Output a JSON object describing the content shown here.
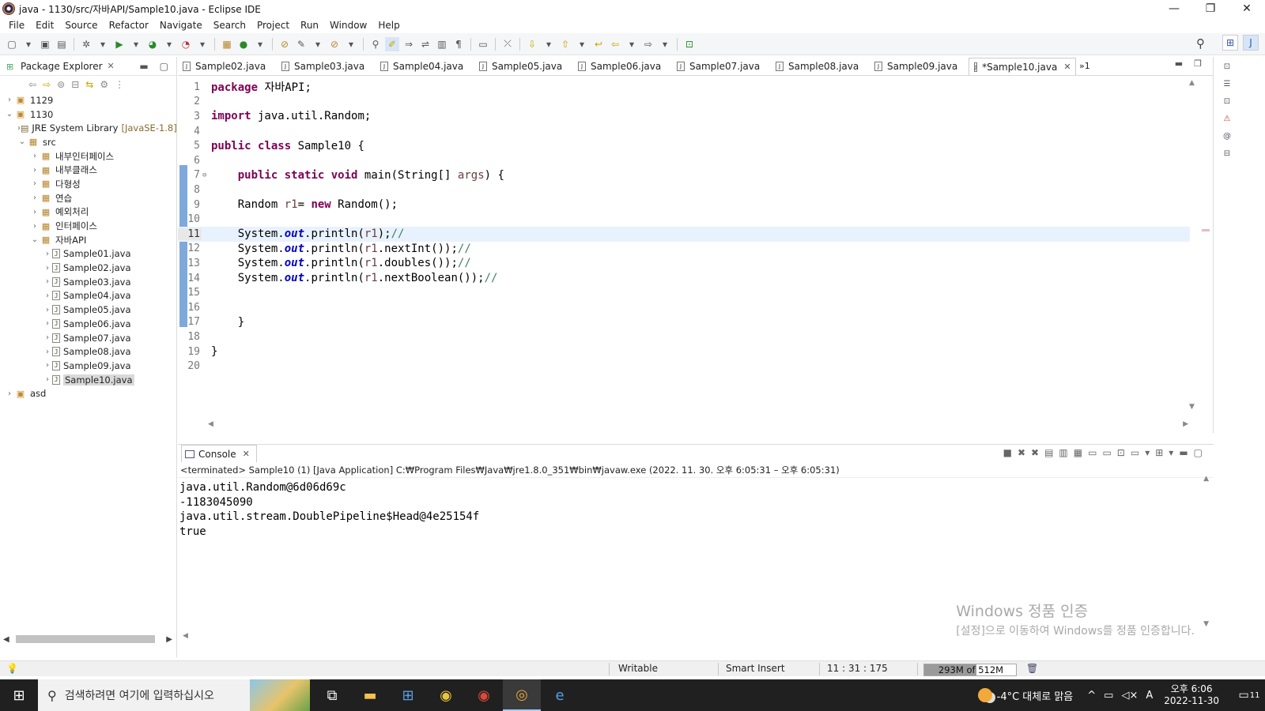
{
  "window": {
    "title": "java - 1130/src/자바API/Sample10.java - Eclipse IDE",
    "controls": [
      "—",
      "❐",
      "✕"
    ]
  },
  "menu": [
    "File",
    "Edit",
    "Source",
    "Refactor",
    "Navigate",
    "Search",
    "Project",
    "Run",
    "Window",
    "Help"
  ],
  "package_explorer": {
    "title": "Package Explorer",
    "tree": [
      {
        "label": "1129",
        "twisty": "›",
        "icon": "project-icon",
        "indent": 0
      },
      {
        "label": "1130",
        "twisty": "⌄",
        "icon": "project-icon",
        "indent": 0
      },
      {
        "label": "JRE System Library",
        "extra": "[JavaSE-1.8]",
        "twisty": "›",
        "icon": "library-icon",
        "indent": 1
      },
      {
        "label": "src",
        "twisty": "⌄",
        "icon": "source-folder-icon",
        "indent": 1
      },
      {
        "label": "내부인터페이스",
        "twisty": "›",
        "icon": "package-icon",
        "indent": 2
      },
      {
        "label": "내부클래스",
        "twisty": "›",
        "icon": "package-icon",
        "indent": 2
      },
      {
        "label": "다형성",
        "twisty": "›",
        "icon": "package-icon",
        "indent": 2
      },
      {
        "label": "연습",
        "twisty": "›",
        "icon": "package-icon",
        "indent": 2
      },
      {
        "label": "예외처리",
        "twisty": "›",
        "icon": "package-icon",
        "indent": 2
      },
      {
        "label": "인터페이스",
        "twisty": "›",
        "icon": "package-icon",
        "indent": 2
      },
      {
        "label": "자바API",
        "twisty": "⌄",
        "icon": "package-icon",
        "indent": 2
      },
      {
        "label": "Sample01.java",
        "twisty": "›",
        "icon": "java-file-icon",
        "indent": 3
      },
      {
        "label": "Sample02.java",
        "twisty": "›",
        "icon": "java-file-icon",
        "indent": 3
      },
      {
        "label": "Sample03.java",
        "twisty": "›",
        "icon": "java-file-icon",
        "indent": 3
      },
      {
        "label": "Sample04.java",
        "twisty": "›",
        "icon": "java-file-icon",
        "indent": 3
      },
      {
        "label": "Sample05.java",
        "twisty": "›",
        "icon": "java-file-icon",
        "indent": 3
      },
      {
        "label": "Sample06.java",
        "twisty": "›",
        "icon": "java-file-icon",
        "indent": 3
      },
      {
        "label": "Sample07.java",
        "twisty": "›",
        "icon": "java-file-icon",
        "indent": 3
      },
      {
        "label": "Sample08.java",
        "twisty": "›",
        "icon": "java-file-icon",
        "indent": 3
      },
      {
        "label": "Sample09.java",
        "twisty": "›",
        "icon": "java-file-icon",
        "indent": 3
      },
      {
        "label": "Sample10.java",
        "twisty": "›",
        "icon": "java-file-icon",
        "indent": 3,
        "selected": true
      },
      {
        "label": "asd",
        "twisty": "›",
        "icon": "project-icon",
        "indent": 0
      }
    ]
  },
  "editor": {
    "tabs": [
      "Sample02.java",
      "Sample03.java",
      "Sample04.java",
      "Sample05.java",
      "Sample06.java",
      "Sample07.java",
      "Sample08.java",
      "Sample09.java",
      "*Sample10.java"
    ],
    "active_tab": 8,
    "overflow_label": "»1",
    "current_line": 11,
    "lines": [
      {
        "n": "1",
        "html": "<span class=\"kw\">package</span> 자바API;"
      },
      {
        "n": "2",
        "html": ""
      },
      {
        "n": "3",
        "html": "<span class=\"kw\">import</span> java.util.Random;"
      },
      {
        "n": "4",
        "html": ""
      },
      {
        "n": "5",
        "html": "<span class=\"kw\">public</span> <span class=\"kw\">class</span> Sample10 {"
      },
      {
        "n": "6",
        "html": ""
      },
      {
        "n": "7",
        "fold": "⊖",
        "html": "    <span class=\"kw\">public</span> <span class=\"kw\">static</span> <span class=\"kw\">void</span> main(String[] <span class=\"var\">args</span>) {"
      },
      {
        "n": "8",
        "html": ""
      },
      {
        "n": "9",
        "html": "    Random <span class=\"var\">r1</span>= <span class=\"kw\">new</span> Random();"
      },
      {
        "n": "10",
        "html": ""
      },
      {
        "n": "11",
        "html": "    System.<span class=\"fld\">out</span>.println(<span class=\"var\">r1</span>);<span class=\"cmt\">//</span>"
      },
      {
        "n": "12",
        "html": "    System.<span class=\"fld\">out</span>.println(<span class=\"var\">r1</span>.nextInt());<span class=\"cmt\">//</span>"
      },
      {
        "n": "13",
        "html": "    System.<span class=\"fld\">out</span>.println(<span class=\"var\">r1</span>.doubles());<span class=\"cmt\">//</span>"
      },
      {
        "n": "14",
        "html": "    System.<span class=\"fld\">out</span>.println(<span class=\"var\">r1</span>.nextBoolean());<span class=\"cmt\">//</span>"
      },
      {
        "n": "15",
        "html": ""
      },
      {
        "n": "16",
        "html": ""
      },
      {
        "n": "17",
        "html": "    }"
      },
      {
        "n": "18",
        "html": ""
      },
      {
        "n": "19",
        "html": "}"
      },
      {
        "n": "20",
        "html": ""
      }
    ]
  },
  "console": {
    "title": "Console",
    "description": "<terminated> Sample10 (1) [Java Application] C:₩Program Files₩Java₩jre1.8.0_351₩bin₩javaw.exe  (2022. 11. 30. 오후 6:05:31 – 오후 6:05:31)",
    "output": [
      "java.util.Random@6d06d69c",
      "-1183045090",
      "java.util.stream.DoublePipeline$Head@4e25154f",
      "true"
    ],
    "watermark_line1": "Windows 정품 인증",
    "watermark_line2": "[설정]으로 이동하여 Windows를 정품 인증합니다."
  },
  "statusbar": {
    "writable": "Writable",
    "insert_mode": "Smart Insert",
    "position": "11 : 31 : 175",
    "heap": "293M of 512M",
    "heap_used_fraction": 0.572
  },
  "taskbar": {
    "search_placeholder": "검색하려면 여기에 입력하십시오",
    "weather": "-4°C  대체로 맑음",
    "time": "오후 6:06",
    "date": "2022-11-30",
    "notification_count": "11"
  }
}
